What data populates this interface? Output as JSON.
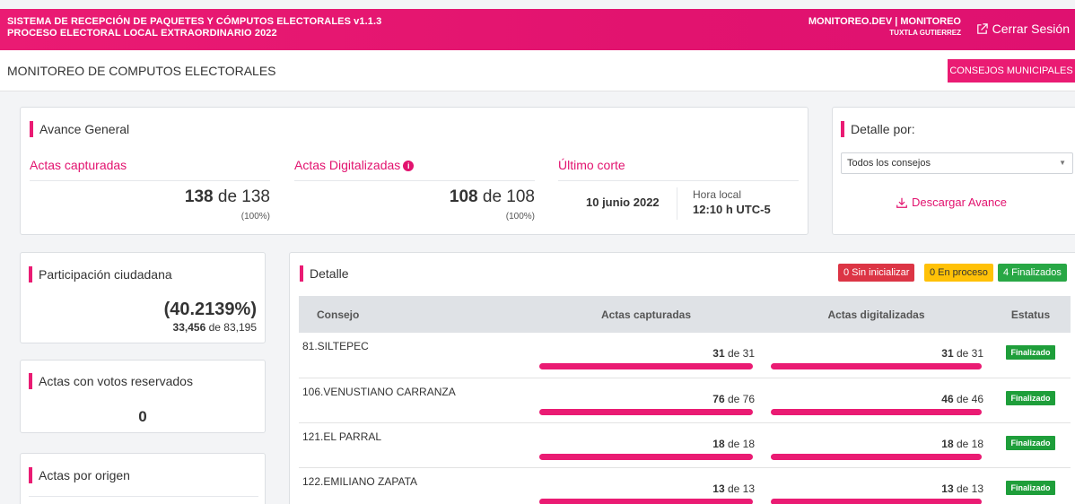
{
  "topbar": {
    "system_line1": "SISTEMA DE RECEPCIÓN DE PAQUETES Y CÓMPUTOS ELECTORALES v1.1.3",
    "system_line2": "PROCESO ELECTORAL LOCAL EXTRAORDINARIO 2022",
    "user_line1": "MONITOREO.DEV | MONITOREO",
    "user_line2": "TUXTLA GUTIERREZ",
    "logout_label": "Cerrar Sesión"
  },
  "subheader": {
    "title": "MONITOREO DE COMPUTOS ELECTORALES",
    "button_label": "CONSEJOS MUNICIPALES"
  },
  "avance": {
    "title": "Avance General",
    "captured": {
      "label": "Actas capturadas",
      "value": "138",
      "of": "de",
      "total": "138",
      "pct": "(100%)"
    },
    "digitized": {
      "label": "Actas Digitalizadas",
      "value": "108",
      "of": "de",
      "total": "108",
      "pct": "(100%)"
    },
    "cut": {
      "label": "Último corte",
      "date": "10 junio 2022",
      "hora_label": "Hora local",
      "hora_value": "12:10 h UTC-5"
    }
  },
  "detalle_por": {
    "title": "Detalle por:",
    "selected": "Todos los consejos",
    "download_label": "Descargar Avance"
  },
  "participacion": {
    "title": "Participación ciudadana",
    "percent": "(40.2139%)",
    "votes": "33,456",
    "of": "de",
    "total": "83,195"
  },
  "reservados": {
    "title": "Actas con votos reservados",
    "value": "0"
  },
  "origen": {
    "title": "Actas por origen"
  },
  "detalle": {
    "title": "Detalle",
    "badges": {
      "sin_iniciar": "0 Sin inicializar",
      "en_proceso": "0 En proceso",
      "finalizados": "4 Finalizados"
    },
    "badge_colors": {
      "sin_iniciar": "#dc3545",
      "en_proceso": "#ffc107",
      "finalizados": "#28a745"
    },
    "columns": [
      "Consejo",
      "Actas capturadas",
      "Actas digitalizadas",
      "Estatus"
    ],
    "rows": [
      {
        "consejo": "81.SILTEPEC",
        "cap_value": "31",
        "cap_total": "31",
        "cap_pct": 100,
        "dig_value": "31",
        "dig_total": "31",
        "dig_pct": 100,
        "status": "Finalizado"
      },
      {
        "consejo": "106.VENUSTIANO CARRANZA",
        "cap_value": "76",
        "cap_total": "76",
        "cap_pct": 100,
        "dig_value": "46",
        "dig_total": "46",
        "dig_pct": 100,
        "status": "Finalizado"
      },
      {
        "consejo": "121.EL PARRAL",
        "cap_value": "18",
        "cap_total": "18",
        "cap_pct": 100,
        "dig_value": "18",
        "dig_total": "18",
        "dig_pct": 100,
        "status": "Finalizado"
      },
      {
        "consejo": "122.EMILIANO ZAPATA",
        "cap_value": "13",
        "cap_total": "13",
        "cap_pct": 100,
        "dig_value": "13",
        "dig_total": "13",
        "dig_pct": 100,
        "status": "Finalizado"
      }
    ]
  },
  "colors": {
    "brand": "#e2136f",
    "status_finalizado": "#1e9e3a"
  }
}
